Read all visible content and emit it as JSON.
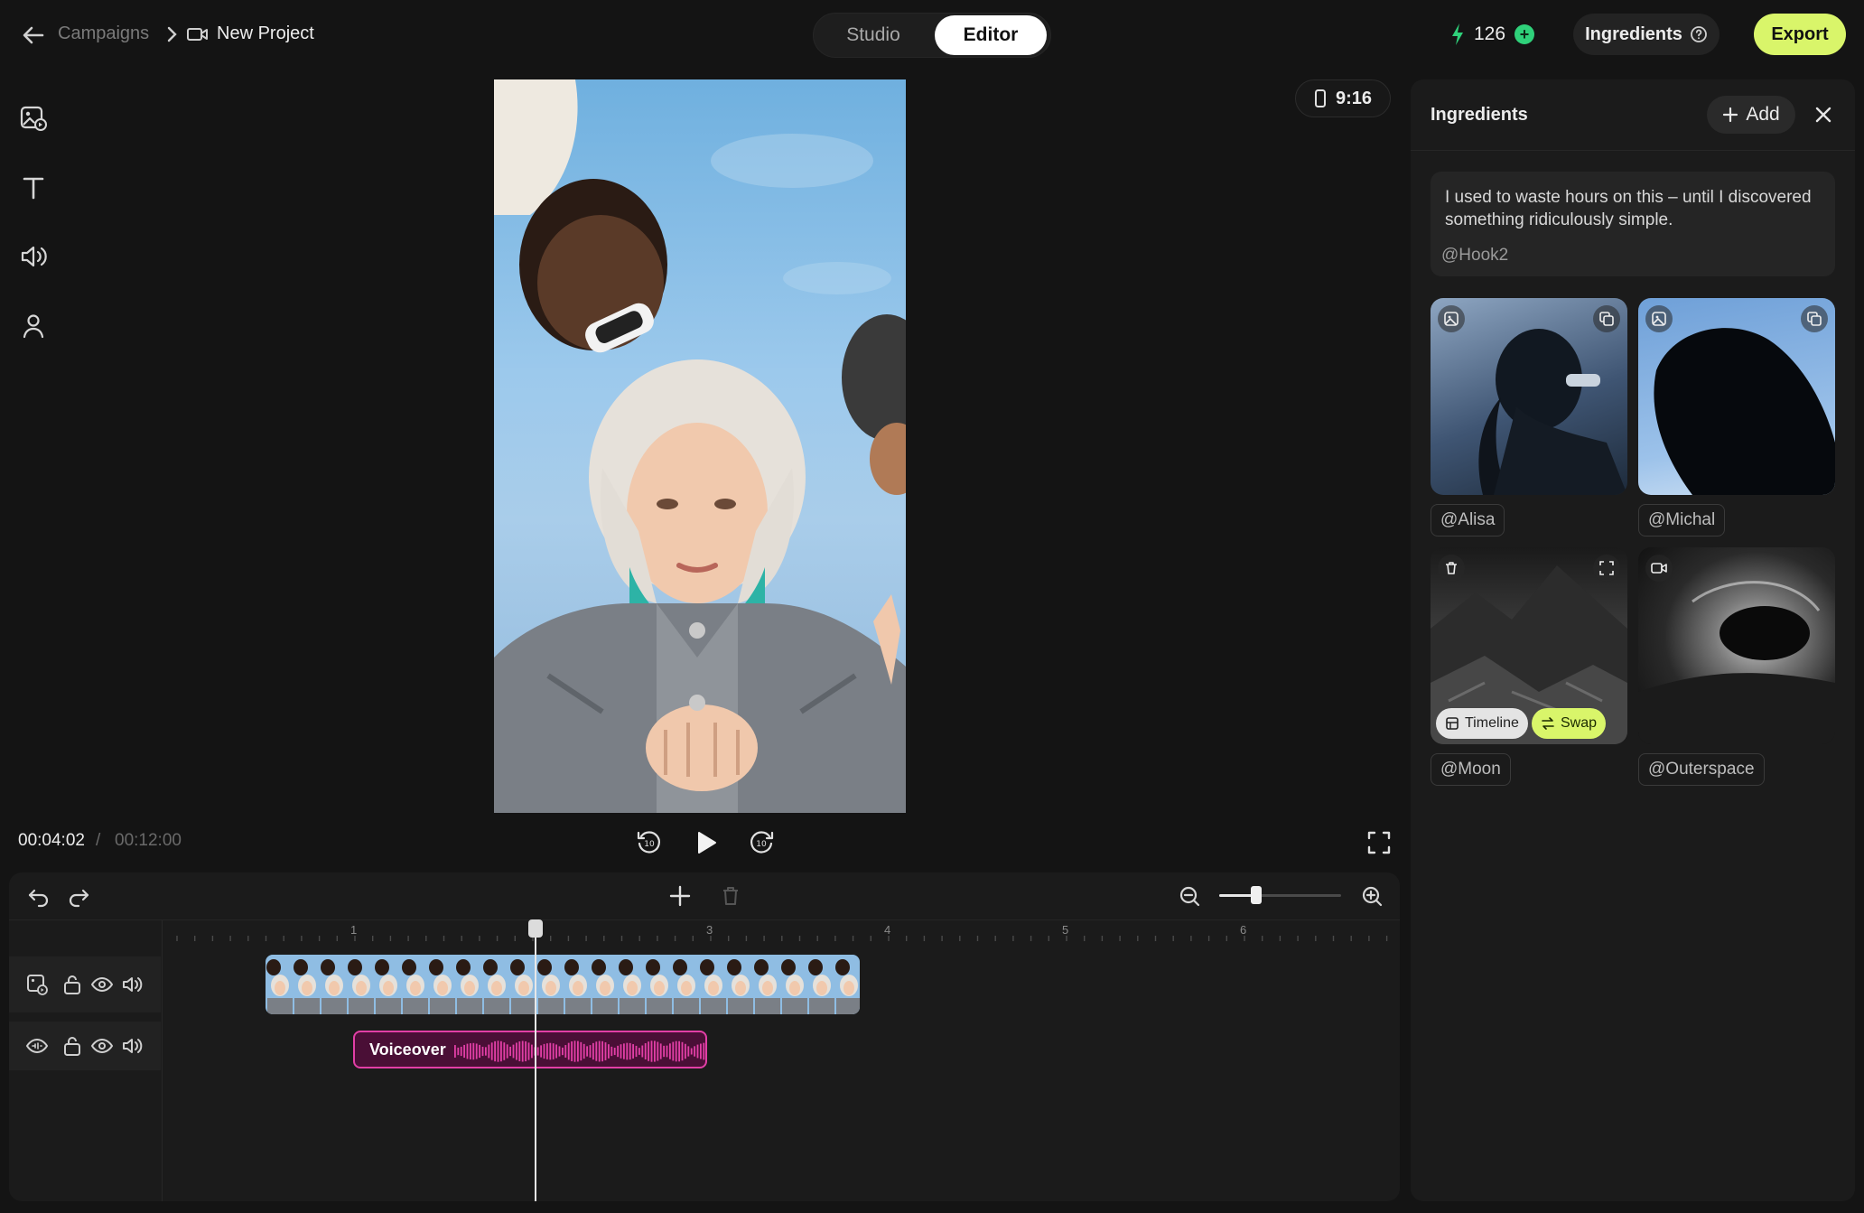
{
  "breadcrumb": {
    "parent": "Campaigns",
    "current": "New Project"
  },
  "mode_switch": {
    "studio": "Studio",
    "editor": "Editor",
    "active": "Editor"
  },
  "credits": {
    "count": "126"
  },
  "header": {
    "ingredients_label": "Ingredients",
    "export_label": "Export"
  },
  "preview": {
    "aspect_ratio": "9:16"
  },
  "playback": {
    "current_time": "00:04:02",
    "separator": "/",
    "total_time": "00:12:00"
  },
  "timeline": {
    "ruler": [
      "1",
      "3",
      "4",
      "5",
      "6"
    ],
    "voice_clip_label": "Voiceover",
    "zoom_level": 0.27
  },
  "ingredients_panel": {
    "title": "Ingredients",
    "add_label": "Add",
    "script": {
      "text": "I used to waste hours on this – until I discovered something ridiculously simple.",
      "tag": "@Hook2"
    },
    "items": [
      {
        "tag": "@Alisa"
      },
      {
        "tag": "@Michal"
      },
      {
        "tag": "@Moon",
        "timeline_label": "Timeline",
        "swap_label": "Swap"
      },
      {
        "tag": "@Outerspace"
      }
    ]
  },
  "colors": {
    "accent": "#d9f56a",
    "voice_clip": "#e23fa6",
    "credit_bolt": "#2fd17a"
  }
}
